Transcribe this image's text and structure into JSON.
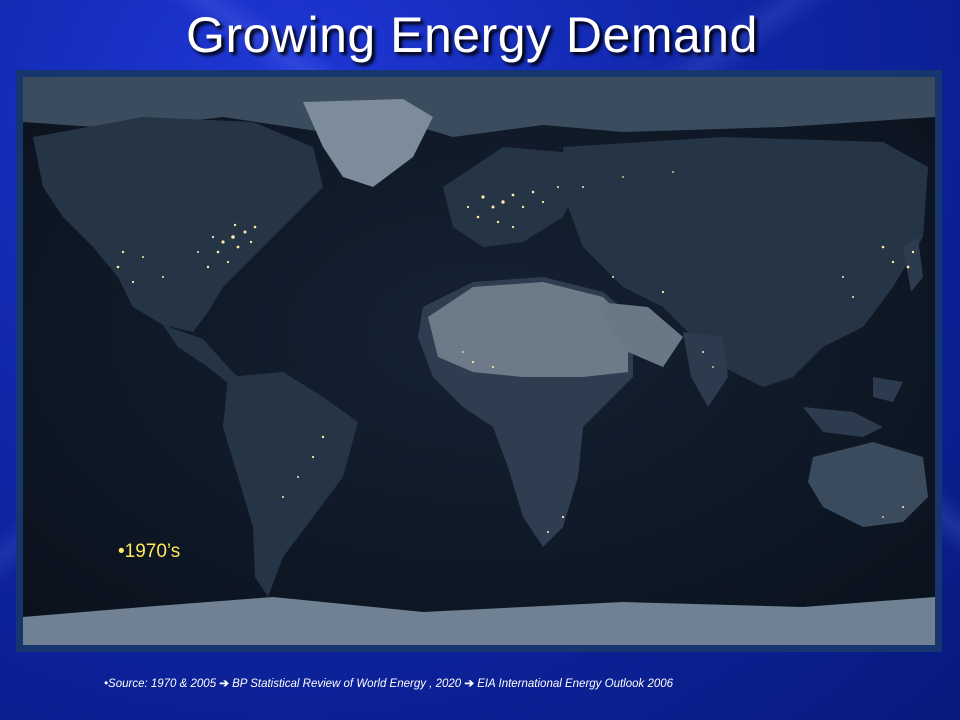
{
  "slide": {
    "title": "Growing Energy Demand",
    "year_label": "•1970’s",
    "source": {
      "bullet": "•",
      "part1": "Source: 1970 & 2005 ",
      "part2": " BP Statistical Review of World Energy , 2020 ",
      "part3": " EIA International Energy Outlook 2006",
      "arrow_glyph": "➔"
    }
  },
  "colors": {
    "background": "#0b1f9a",
    "title_text": "#ffffff",
    "year_label_text": "#ffe65c",
    "map_ocean": "#0d1726",
    "land": "#2a3a4e",
    "desert": "#6e7c8a",
    "ice": "#8495a4",
    "city_lights": "#ffe9a8"
  }
}
